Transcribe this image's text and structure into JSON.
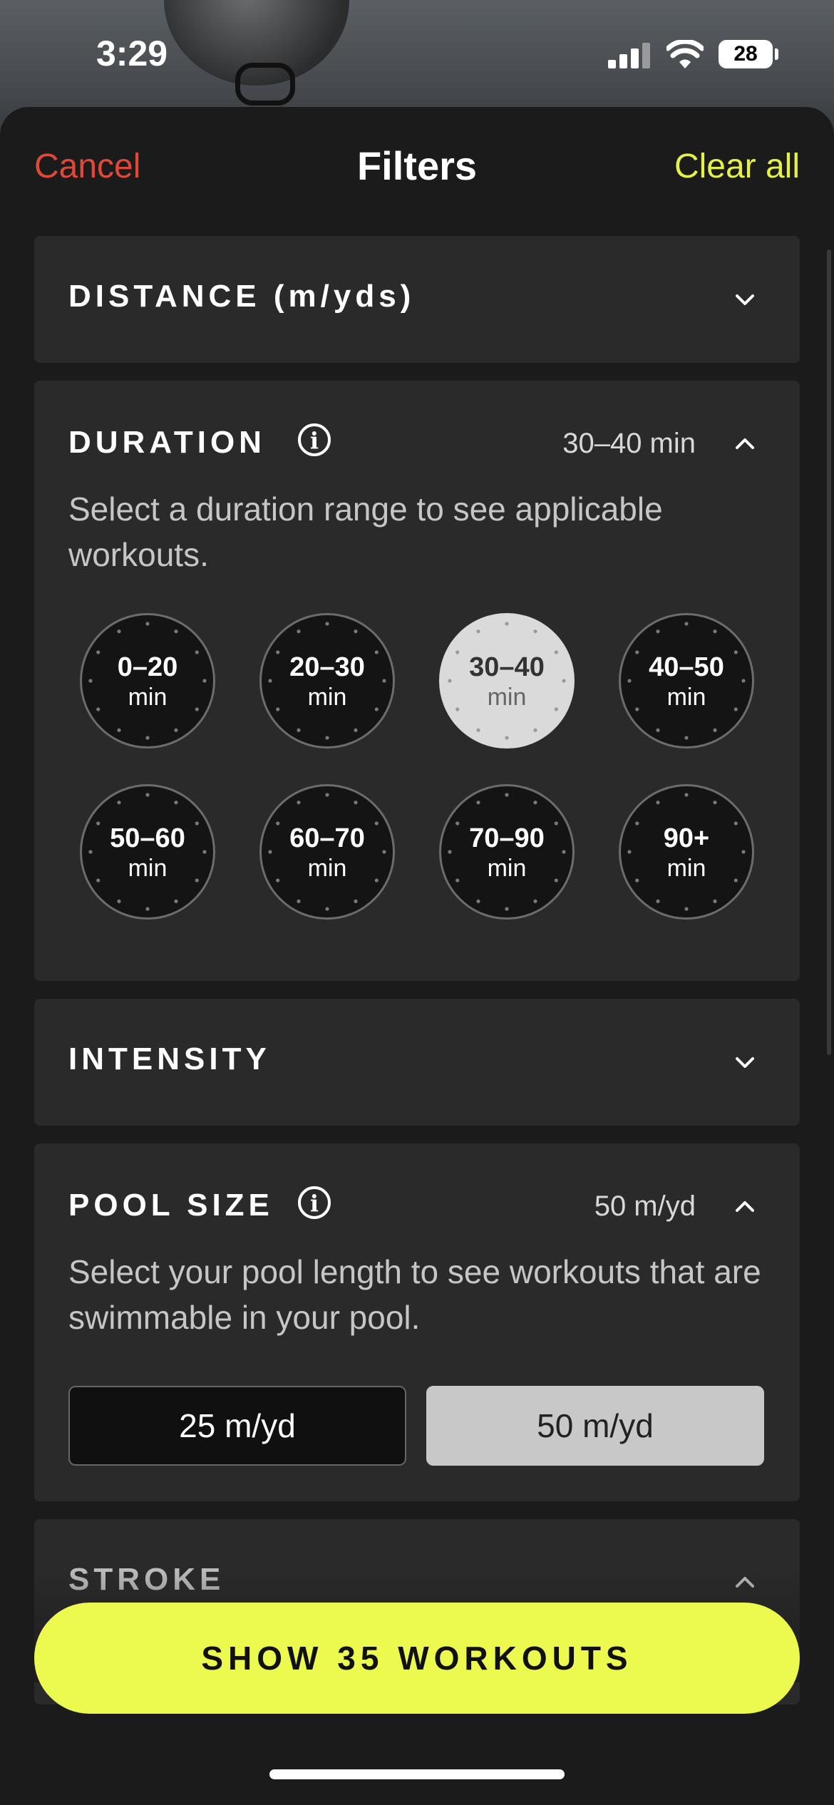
{
  "status_bar": {
    "time": "3:29",
    "battery": "28"
  },
  "header": {
    "cancel": "Cancel",
    "title": "Filters",
    "clear_all": "Clear all"
  },
  "distance": {
    "title": "DISTANCE (m/yds)"
  },
  "duration": {
    "title": "DURATION",
    "value": "30–40 min",
    "description": "Select a duration range to see applicable workouts.",
    "options": [
      {
        "range": "0–20",
        "unit": "min",
        "selected": false
      },
      {
        "range": "20–30",
        "unit": "min",
        "selected": false
      },
      {
        "range": "30–40",
        "unit": "min",
        "selected": true
      },
      {
        "range": "40–50",
        "unit": "min",
        "selected": false
      },
      {
        "range": "50–60",
        "unit": "min",
        "selected": false
      },
      {
        "range": "60–70",
        "unit": "min",
        "selected": false
      },
      {
        "range": "70–90",
        "unit": "min",
        "selected": false
      },
      {
        "range": "90+",
        "unit": "min",
        "selected": false
      }
    ]
  },
  "intensity": {
    "title": "INTENSITY"
  },
  "pool_size": {
    "title": "POOL SIZE",
    "value": "50 m/yd",
    "description": "Select your pool length to see workouts that are swimmable in your pool.",
    "options": [
      {
        "label": "25 m/yd",
        "selected": false
      },
      {
        "label": "50 m/yd",
        "selected": true
      }
    ]
  },
  "stroke": {
    "title": "STROKE"
  },
  "cta": {
    "label": "SHOW 35 WORKOUTS"
  },
  "colors": {
    "accent": "#ecfa50",
    "cancel": "#e0483a",
    "card": "#2a2a2a",
    "sheet": "#1b1b1b"
  }
}
